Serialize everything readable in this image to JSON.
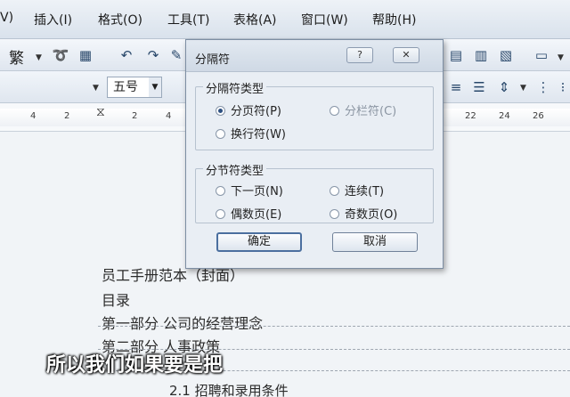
{
  "menu": [
    {
      "label": "V)"
    },
    {
      "label": "插入(I)"
    },
    {
      "label": "格式(O)"
    },
    {
      "label": "工具(T)"
    },
    {
      "label": "表格(A)"
    },
    {
      "label": "窗口(W)"
    },
    {
      "label": "帮助(H)"
    }
  ],
  "toolbar1": {
    "traditional_label": "繁"
  },
  "toolbar2": {
    "font_size": "五号"
  },
  "ruler": {
    "ticks": [
      "4",
      "2",
      "2",
      "4",
      "22",
      "24",
      "26"
    ]
  },
  "dialog": {
    "title": "分隔符",
    "help_button": "?",
    "close_button": "✕",
    "break_types": {
      "legend": "分隔符类型",
      "page_break": "分页符(P)",
      "column_break": "分栏符(C)",
      "line_break": "换行符(W)"
    },
    "section_types": {
      "legend": "分节符类型",
      "next_page": "下一页(N)",
      "continuous": "连续(T)",
      "even_page": "偶数页(E)",
      "odd_page": "奇数页(O)"
    },
    "ok_label": "确定",
    "cancel_label": "取消"
  },
  "document": {
    "lines": [
      "员工手册范本（封面）",
      "目录",
      "第一部分  公司的经营理念",
      "第二部分  人事政策",
      "2.1  招聘和录用条件"
    ]
  },
  "subtitle": "所以我们如果要是把"
}
